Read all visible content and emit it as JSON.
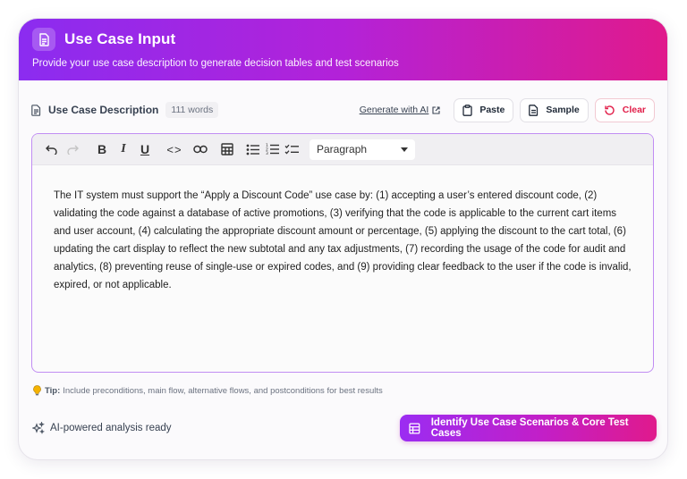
{
  "header": {
    "title": "Use Case Input",
    "subtitle": "Provide your use case description to generate decision tables and test scenarios",
    "icon": "document-icon"
  },
  "toolbar": {
    "label": "Use Case Description",
    "word_count": "111 words",
    "generate_link": "Generate with AI",
    "paste_label": "Paste",
    "sample_label": "Sample",
    "clear_label": "Clear"
  },
  "editor": {
    "format_select": "Paragraph",
    "bold": "B",
    "italic": "I",
    "underline": "U",
    "code": "<>",
    "content": "The IT system must support the “Apply a Discount Code” use case by: (1) accepting a user’s entered discount code, (2) validating the code against a database of active promotions, (3) verifying that the code is applicable to the current cart items and user account, (4) calculating the appropriate discount amount or percentage, (5) applying the discount to the cart total, (6) updating the cart display to reflect the new subtotal and any tax adjustments, (7) recording the usage of the code for audit and analytics, (8) preventing reuse of single-use or expired codes, and (9) providing clear feedback to the user if the code is invalid, expired, or not applicable."
  },
  "tip": {
    "label": "Tip:",
    "text": "Include preconditions, main flow, alternative flows, and postconditions for best results"
  },
  "footer": {
    "status": "AI-powered analysis ready",
    "cta_label": "Identify Use Case Scenarios & Core Test Cases"
  },
  "colors": {
    "gradient_start": "#8b2cf0",
    "gradient_end": "#e01a8c",
    "clear_red": "#e11d48",
    "editor_border": "#c18df3"
  }
}
